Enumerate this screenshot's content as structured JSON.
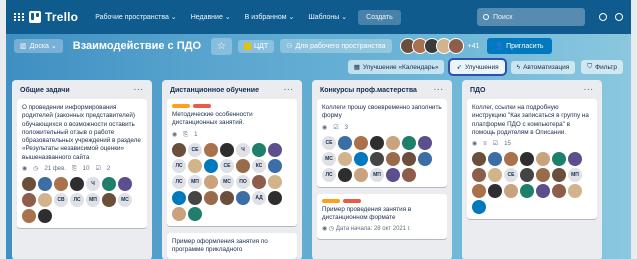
{
  "topnav": {
    "logo": "Trello",
    "items": [
      "Рабочие пространства ⌄",
      "Недавние ⌄",
      "В избранном ⌄",
      "Шаблоны ⌄"
    ],
    "create": "Создать",
    "search_placeholder": "Поиск"
  },
  "board": {
    "view": "Доска ⌄",
    "title": "Взаимодействие с ПДО",
    "badge": "ЦДТ",
    "visibility": "Для рабочего пространства",
    "member_count": "+41",
    "invite": "Пригласить"
  },
  "powerups": [
    "Улучшение «Календарь»",
    "Улучшения",
    "Автоматизация",
    "Фильтр"
  ],
  "lists": [
    {
      "title": "Общие задачи",
      "cards": [
        {
          "text": "О проведении информирования родителей (законных представителей) обучающихся о возможности оставить положительный отзыв о работе образовательных учреждений в разделе «Результаты независимой оценки» вышеназванного сайта",
          "meta": [
            "21 фев.",
            "10",
            "2"
          ],
          "avatars": [
            "",
            "",
            "",
            "",
            "Ч",
            "",
            "",
            "",
            "",
            "СВ",
            "ЛС",
            "МП",
            "",
            "МС",
            "",
            ""
          ]
        }
      ]
    },
    {
      "title": "Дистанционное обучение",
      "cards": [
        {
          "text": "Методические особенности дистанционных занятий.",
          "meta": [
            "",
            "1"
          ],
          "avatars": [
            "",
            "СЕ",
            "",
            "",
            "Ч",
            "",
            "",
            "ЛС",
            "",
            "",
            "СЕ",
            "",
            "КС",
            "",
            "ЛС",
            "МП",
            "",
            "МС",
            "ПО",
            "",
            "",
            "",
            "",
            "",
            "",
            "",
            "АД",
            "",
            "",
            ""
          ]
        },
        {
          "text": "Пример оформления занятия по программе прикладного"
        }
      ]
    },
    {
      "title": "Конкурсы проф.мастерства",
      "cards": [
        {
          "text": "Коллеги прошу своевременно заполнить форму",
          "meta": [
            "",
            "3"
          ],
          "avatars": [
            "СЕ",
            "",
            "",
            "",
            "",
            "",
            "",
            "МС",
            "",
            "",
            "",
            "",
            "",
            "",
            "ЛС",
            "",
            "",
            "МП",
            "",
            ""
          ]
        },
        {
          "text": "Пример проведения занятия в дистанционном формате",
          "date": "Дата начала: 28 окт 2021 г."
        }
      ]
    },
    {
      "title": "ПДО",
      "cards": [
        {
          "text": "Коллег, ссылки на подробную инструкцию \"Как записаться в группу на платформе ПДО с компьютера\" в помощь родителям в Описании.",
          "meta": [
            "",
            "15"
          ],
          "avatars": [
            "",
            "",
            "",
            "",
            "",
            "",
            "",
            "",
            "",
            "СЕ",
            "",
            "",
            "",
            "МП",
            "",
            "",
            "",
            "",
            "",
            "",
            "",
            ""
          ]
        }
      ]
    }
  ],
  "colors": {
    "nav": "#0f5b8e",
    "label_orange": "#ff9f1a",
    "label_red": "#eb5a46",
    "accent": "#0079bf"
  }
}
